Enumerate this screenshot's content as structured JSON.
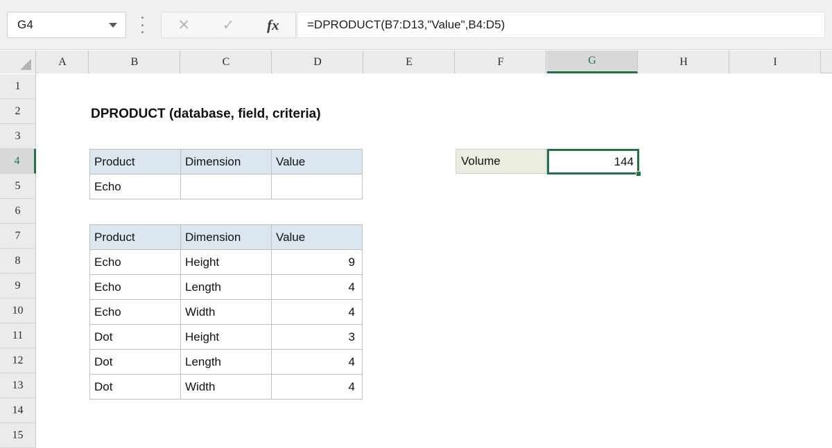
{
  "formula_bar": {
    "name_box_value": "G4",
    "cancel_icon": "close-icon",
    "confirm_icon": "check-icon",
    "function_icon": "fx-icon",
    "function_label": "fx",
    "formula_value": "=DPRODUCT(B7:D13,\"Value\",B4:D5)"
  },
  "grid": {
    "columns": [
      "A",
      "B",
      "C",
      "D",
      "E",
      "F",
      "G",
      "H",
      "I"
    ],
    "selected_column": "G",
    "rows": [
      "1",
      "2",
      "3",
      "4",
      "5",
      "6",
      "7",
      "8",
      "9",
      "10",
      "11",
      "12",
      "13",
      "14",
      "15"
    ],
    "selected_row": "4"
  },
  "sheet": {
    "title": "DPRODUCT (database, field, criteria)",
    "criteria_table": {
      "headers": [
        "Product",
        "Dimension",
        "Value"
      ],
      "rows": [
        [
          "Echo",
          "",
          ""
        ]
      ]
    },
    "data_table": {
      "headers": [
        "Product",
        "Dimension",
        "Value"
      ],
      "rows": [
        [
          "Echo",
          "Height",
          "9"
        ],
        [
          "Echo",
          "Length",
          "4"
        ],
        [
          "Echo",
          "Width",
          "4"
        ],
        [
          "Dot",
          "Height",
          "3"
        ],
        [
          "Dot",
          "Length",
          "4"
        ],
        [
          "Dot",
          "Width",
          "4"
        ]
      ]
    },
    "result": {
      "label": "Volume",
      "value": "144"
    }
  },
  "colors": {
    "selection_green": "#217346",
    "table_header_fill": "#dce6f1",
    "label_fill": "#eaeee0",
    "header_bar": "#ebebeb"
  }
}
